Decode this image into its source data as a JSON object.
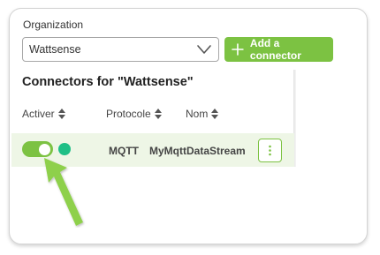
{
  "organization": {
    "label": "Organization",
    "selected": "Wattsense"
  },
  "add_connector_button": {
    "label": "Add a connector",
    "icon": "plus-icon"
  },
  "connectors": {
    "title": "Connectors for \"Wattsense\"",
    "columns": [
      "Activer",
      "Protocole",
      "Nom"
    ],
    "rows": [
      {
        "enabled": true,
        "status": "connected",
        "protocol": "MQTT",
        "name": "MyMqttDataStream"
      }
    ]
  },
  "colors": {
    "accent": "#7cc242",
    "status_dot": "#1fbf86",
    "row_highlight": "#eef6e6"
  }
}
